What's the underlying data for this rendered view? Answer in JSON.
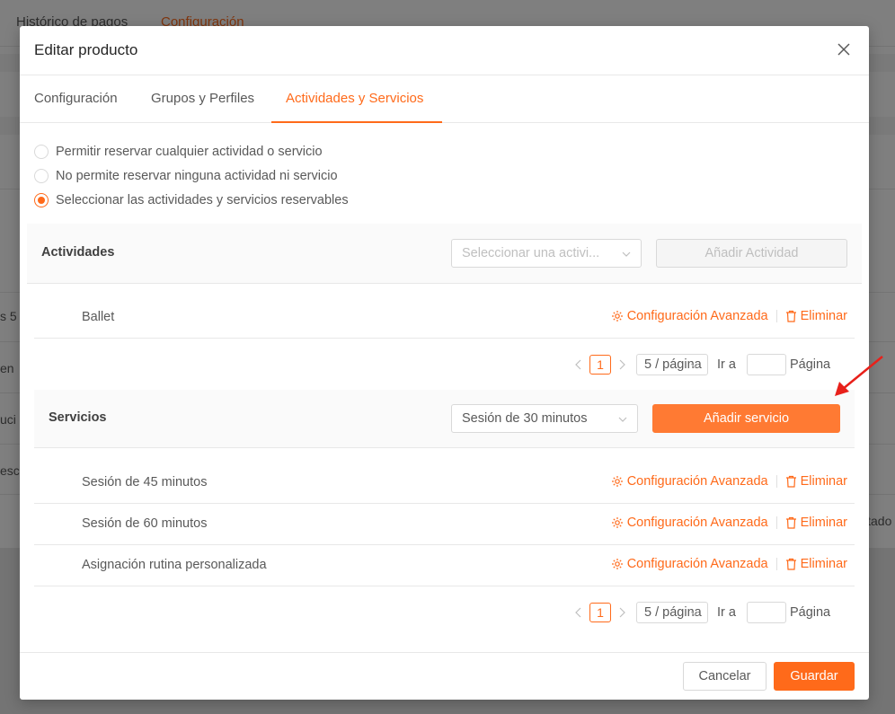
{
  "background": {
    "tabs": [
      {
        "label": "Histórico de pagos"
      },
      {
        "label": "Configuración"
      }
    ],
    "edge_fragments": [
      "s 5",
      "en",
      "uci",
      "esc",
      "ltado"
    ]
  },
  "modal": {
    "title": "Editar producto",
    "close_icon": "close-icon",
    "tabs": [
      {
        "label": "Configuración"
      },
      {
        "label": "Grupos y Perfiles"
      },
      {
        "label": "Actividades y Servicios",
        "active": true
      }
    ],
    "options": [
      {
        "label": "Permitir reservar cualquier actividad o servicio",
        "checked": false
      },
      {
        "label": "No permite reservar ninguna actividad ni servicio",
        "checked": false
      },
      {
        "label": "Seleccionar las actividades y servicios reservables",
        "checked": true
      }
    ],
    "activities": {
      "title": "Actividades",
      "select_placeholder": "Seleccionar una activi...",
      "add_button": "Añadir Actividad",
      "items": [
        {
          "name": "Ballet"
        }
      ],
      "pagination": {
        "current_page": "1",
        "page_size": "5 / página",
        "goto_label": "Ir a",
        "page_label": "Página"
      }
    },
    "services": {
      "title": "Servicios",
      "select_value": "Sesión de 30 minutos",
      "add_button": "Añadir servicio",
      "items": [
        {
          "name": "Sesión de 45 minutos"
        },
        {
          "name": "Sesión de 60 minutos"
        },
        {
          "name": "Asignación rutina personalizada"
        }
      ],
      "pagination": {
        "current_page": "1",
        "page_size": "5 / página",
        "goto_label": "Ir a",
        "page_label": "Página"
      }
    },
    "row_actions": {
      "advanced_config": "Configuración Avanzada",
      "delete": "Eliminar",
      "advanced_icon": "gear-icon",
      "delete_icon": "trash-icon"
    },
    "footer": {
      "cancel": "Cancelar",
      "save": "Guardar"
    }
  },
  "colors": {
    "accent": "#ff6a1a",
    "annotation_arrow": "#e8201a"
  }
}
